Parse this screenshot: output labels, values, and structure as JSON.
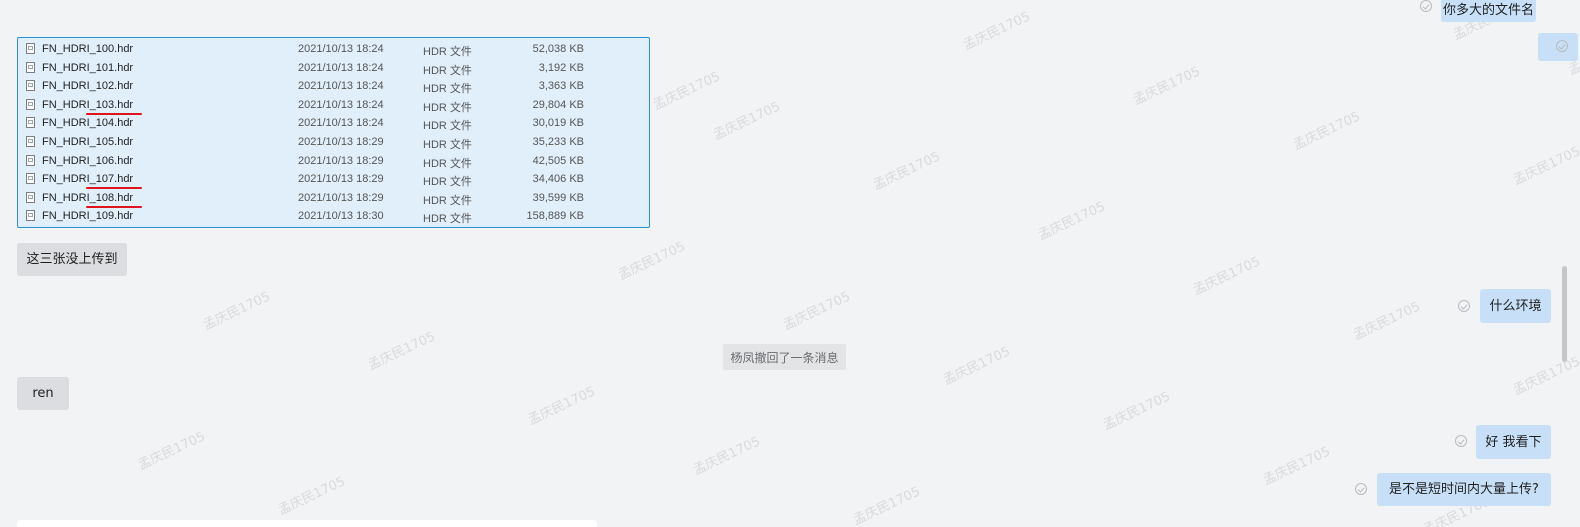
{
  "watermark_text": "孟庆民1705",
  "files": [
    {
      "name": "FN_HDRI_100.hdr",
      "date": "2021/10/13 18:24",
      "type": "HDR 文件",
      "size": "52,038 KB",
      "marked": false
    },
    {
      "name": "FN_HDRI_101.hdr",
      "date": "2021/10/13 18:24",
      "type": "HDR 文件",
      "size": "3,192 KB",
      "marked": false
    },
    {
      "name": "FN_HDRI_102.hdr",
      "date": "2021/10/13 18:24",
      "type": "HDR 文件",
      "size": "3,363 KB",
      "marked": false
    },
    {
      "name": "FN_HDRI_103.hdr",
      "date": "2021/10/13 18:24",
      "type": "HDR 文件",
      "size": "29,804 KB",
      "marked": true
    },
    {
      "name": "FN_HDRI_104.hdr",
      "date": "2021/10/13 18:24",
      "type": "HDR 文件",
      "size": "30,019 KB",
      "marked": false
    },
    {
      "name": "FN_HDRI_105.hdr",
      "date": "2021/10/13 18:29",
      "type": "HDR 文件",
      "size": "35,233 KB",
      "marked": false
    },
    {
      "name": "FN_HDRI_106.hdr",
      "date": "2021/10/13 18:29",
      "type": "HDR 文件",
      "size": "42,505 KB",
      "marked": false
    },
    {
      "name": "FN_HDRI_107.hdr",
      "date": "2021/10/13 18:29",
      "type": "HDR 文件",
      "size": "34,406 KB",
      "marked": true
    },
    {
      "name": "FN_HDRI_108.hdr",
      "date": "2021/10/13 18:29",
      "type": "HDR 文件",
      "size": "39,599 KB",
      "marked": true
    },
    {
      "name": "FN_HDRI_109.hdr",
      "date": "2021/10/13 18:30",
      "type": "HDR 文件",
      "size": "158,889 KB",
      "marked": false
    }
  ],
  "messages": {
    "top_right": "你多大的文件名",
    "left_1": "这三张没上传到",
    "right_1": "什么环境",
    "system_recall": "杨凤撤回了一条消息",
    "left_2": "ren",
    "right_2": "好 我看下",
    "right_3": "是不是短时间内大量上传?"
  },
  "colors": {
    "background": "#f2f3f5",
    "bubble_self": "#c7e0f7",
    "bubble_other": "#dcdde0",
    "file_panel": "#e1effa",
    "file_panel_border": "#2a8fd4",
    "annotation_underline": "#e0141e"
  }
}
